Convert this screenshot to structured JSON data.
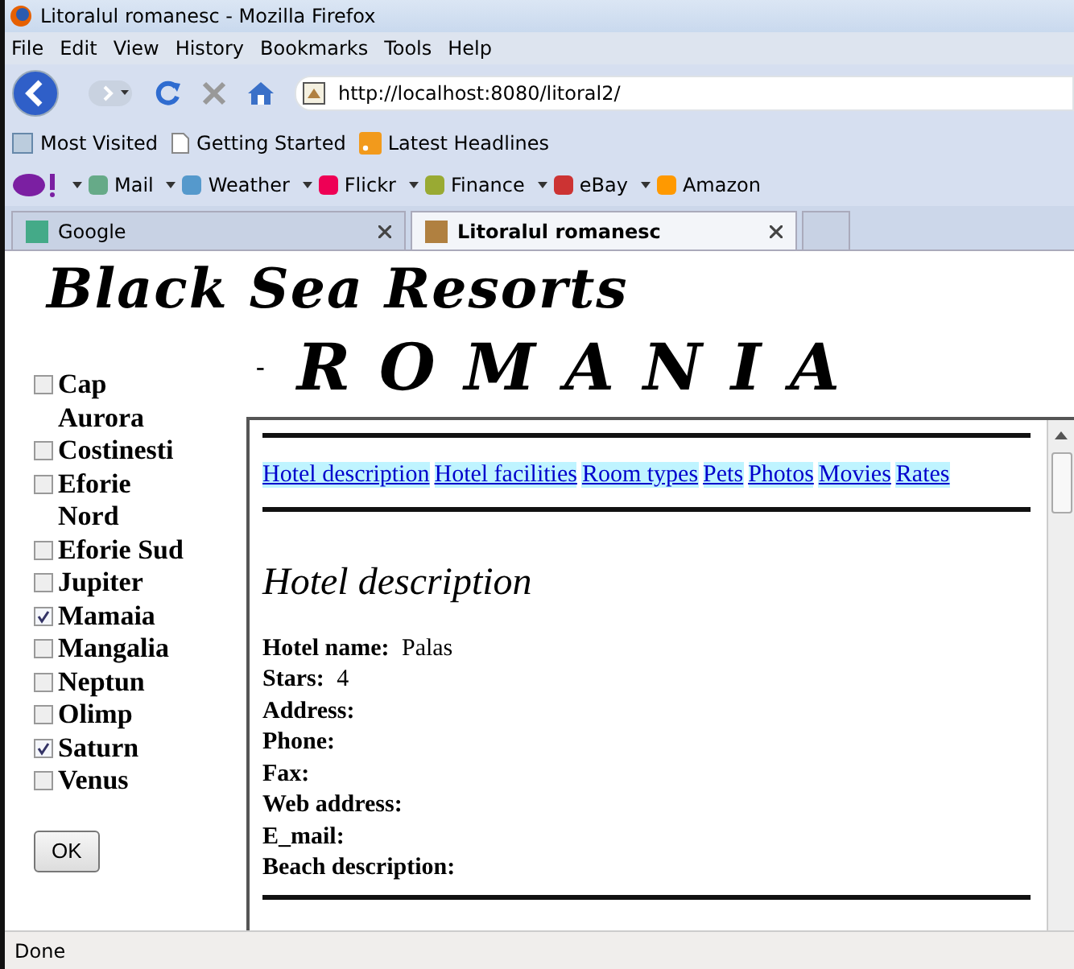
{
  "window": {
    "title": "Litoralul romanesc - Mozilla Firefox"
  },
  "menu": [
    "File",
    "Edit",
    "View",
    "History",
    "Bookmarks",
    "Tools",
    "Help"
  ],
  "address": {
    "value": "http://localhost:8080/litoral2/"
  },
  "bookmarks": [
    "Most Visited",
    "Getting Started",
    "Latest Headlines"
  ],
  "yahoo_toolbar": [
    "Mail",
    "Weather",
    "Flickr",
    "Finance",
    "eBay",
    "Amazon"
  ],
  "tabs": [
    {
      "label": "Google",
      "selected": false
    },
    {
      "label": "Litoralul romanesc",
      "selected": true
    }
  ],
  "page": {
    "title": "Black Sea Resorts",
    "subtitle_mark": "-",
    "subtitle": "R O M A N I A",
    "resorts": [
      {
        "lines": [
          "Cap",
          "Aurora"
        ],
        "checked": false
      },
      {
        "lines": [
          "Costinesti"
        ],
        "checked": false
      },
      {
        "lines": [
          "Eforie",
          "Nord"
        ],
        "checked": false
      },
      {
        "lines": [
          "Eforie Sud"
        ],
        "checked": false
      },
      {
        "lines": [
          "Jupiter"
        ],
        "checked": false
      },
      {
        "lines": [
          "Mamaia"
        ],
        "checked": true
      },
      {
        "lines": [
          "Mangalia"
        ],
        "checked": false
      },
      {
        "lines": [
          "Neptun"
        ],
        "checked": false
      },
      {
        "lines": [
          "Olimp"
        ],
        "checked": false
      },
      {
        "lines": [
          "Saturn"
        ],
        "checked": true
      },
      {
        "lines": [
          "Venus"
        ],
        "checked": false
      }
    ],
    "ok_button": "OK",
    "links": [
      "Hotel description",
      "Hotel facilities",
      "Room types",
      "Pets",
      "Photos",
      "Movies",
      "Rates"
    ],
    "heading": "Hotel description",
    "fields": [
      {
        "label": "Hotel name:",
        "value": "Palas"
      },
      {
        "label": "Stars:",
        "value": "4"
      },
      {
        "label": "Address:"
      },
      {
        "label": "Phone:"
      },
      {
        "label": "Fax:"
      },
      {
        "label": "Web address:"
      },
      {
        "label": "E_mail:"
      },
      {
        "label": "Beach description:"
      }
    ]
  },
  "status_bar": "Done"
}
